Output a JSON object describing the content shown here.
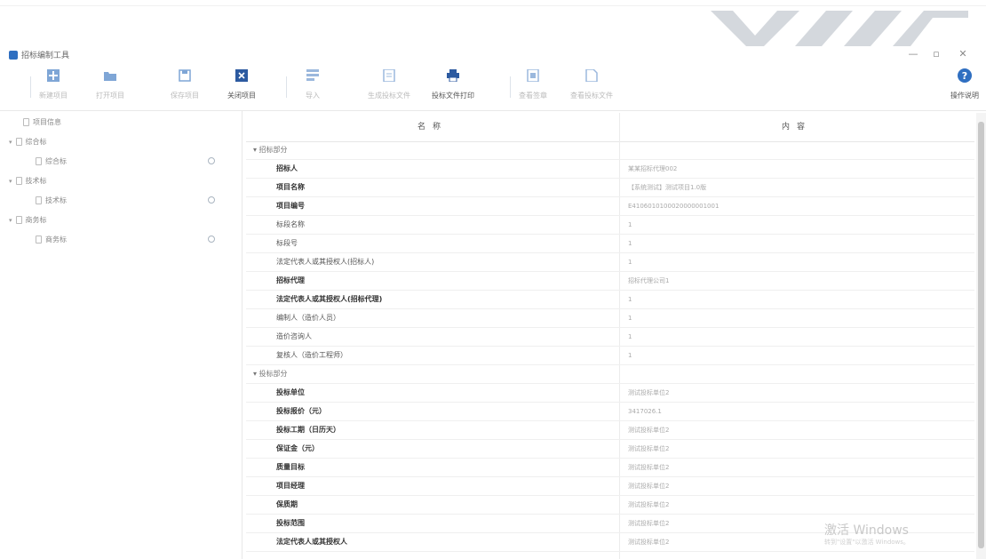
{
  "window": {
    "title": "招标编制工具",
    "minimize": "—",
    "maximize": "▫",
    "close": "✕"
  },
  "toolbar": {
    "buttons": [
      {
        "label": "新建项目",
        "icon": "new-project-icon",
        "active": false
      },
      {
        "label": "打开项目",
        "icon": "folder-icon",
        "active": false
      },
      {
        "label": "保存项目",
        "icon": "save-icon",
        "active": false
      },
      {
        "label": "关闭项目",
        "icon": "close-project-icon",
        "active": true
      },
      {
        "label": "导入",
        "icon": "import-icon",
        "active": false
      },
      {
        "label": "生成投标文件",
        "icon": "generate-file-icon",
        "active": false
      },
      {
        "label": "投标文件打印",
        "icon": "print-icon",
        "active": true
      },
      {
        "label": "查看签章",
        "icon": "seal-icon",
        "active": false
      },
      {
        "label": "查看投标文件",
        "icon": "view-file-icon",
        "active": false
      }
    ],
    "help_label": "操作说明"
  },
  "sidebar": {
    "items": [
      {
        "label": "项目信息",
        "level": 0,
        "expandable": false,
        "checked": false
      },
      {
        "label": "综合标",
        "level": 0,
        "expandable": true,
        "checked": false
      },
      {
        "label": "综合标",
        "level": 1,
        "expandable": false,
        "checked": true
      },
      {
        "label": "技术标",
        "level": 0,
        "expandable": true,
        "checked": false
      },
      {
        "label": "技术标",
        "level": 1,
        "expandable": false,
        "checked": true
      },
      {
        "label": "商务标",
        "level": 0,
        "expandable": true,
        "checked": false
      },
      {
        "label": "商务标",
        "level": 1,
        "expandable": false,
        "checked": true
      }
    ]
  },
  "grid": {
    "headers": [
      "名称",
      "内容"
    ],
    "rows": [
      {
        "name": "▾ 招标部分",
        "value": "",
        "group": true,
        "bold": false
      },
      {
        "name": "招标人",
        "value": "某某招标代理002",
        "group": false,
        "bold": true
      },
      {
        "name": "项目名称",
        "value": "【系统测试】测试项目1.0版",
        "group": false,
        "bold": true
      },
      {
        "name": "项目编号",
        "value": "E4106010100020000001001",
        "group": false,
        "bold": true
      },
      {
        "name": "标段名称",
        "value": "1",
        "group": false,
        "bold": false
      },
      {
        "name": "标段号",
        "value": "1",
        "group": false,
        "bold": false
      },
      {
        "name": "法定代表人或其授权人(招标人)",
        "value": "1",
        "group": false,
        "bold": false
      },
      {
        "name": "招标代理",
        "value": "招标代理公司1",
        "group": false,
        "bold": true
      },
      {
        "name": "法定代表人或其授权人(招标代理)",
        "value": "1",
        "group": false,
        "bold": true
      },
      {
        "name": "编制人（造价人员）",
        "value": "1",
        "group": false,
        "bold": false
      },
      {
        "name": "造价咨询人",
        "value": "1",
        "group": false,
        "bold": false
      },
      {
        "name": "复核人（造价工程师）",
        "value": "1",
        "group": false,
        "bold": false
      },
      {
        "name": "▾ 投标部分",
        "value": "",
        "group": true,
        "bold": false
      },
      {
        "name": "投标单位",
        "value": "测试投标单位2",
        "group": false,
        "bold": true
      },
      {
        "name": "投标报价（元）",
        "value": "3417026.1",
        "group": false,
        "bold": true
      },
      {
        "name": "投标工期（日历天）",
        "value": "测试投标单位2",
        "group": false,
        "bold": true
      },
      {
        "name": "保证金（元）",
        "value": "测试投标单位2",
        "group": false,
        "bold": true
      },
      {
        "name": "质量目标",
        "value": "测试投标单位2",
        "group": false,
        "bold": true
      },
      {
        "name": "项目经理",
        "value": "测试投标单位2",
        "group": false,
        "bold": true
      },
      {
        "name": "保质期",
        "value": "测试投标单位2",
        "group": false,
        "bold": true
      },
      {
        "name": "投标范围",
        "value": "测试投标单位2",
        "group": false,
        "bold": true
      },
      {
        "name": "法定代表人或其授权人",
        "value": "测试投标单位2",
        "group": false,
        "bold": true
      }
    ]
  },
  "watermark": {
    "line1": "激活 Windows",
    "line2": "转到\"设置\"以激活 Windows。"
  },
  "colors": {
    "accent": "#2f6fc1",
    "toolbar_icon": "#7fa6d6",
    "close_icon": "#2c5aa0"
  }
}
